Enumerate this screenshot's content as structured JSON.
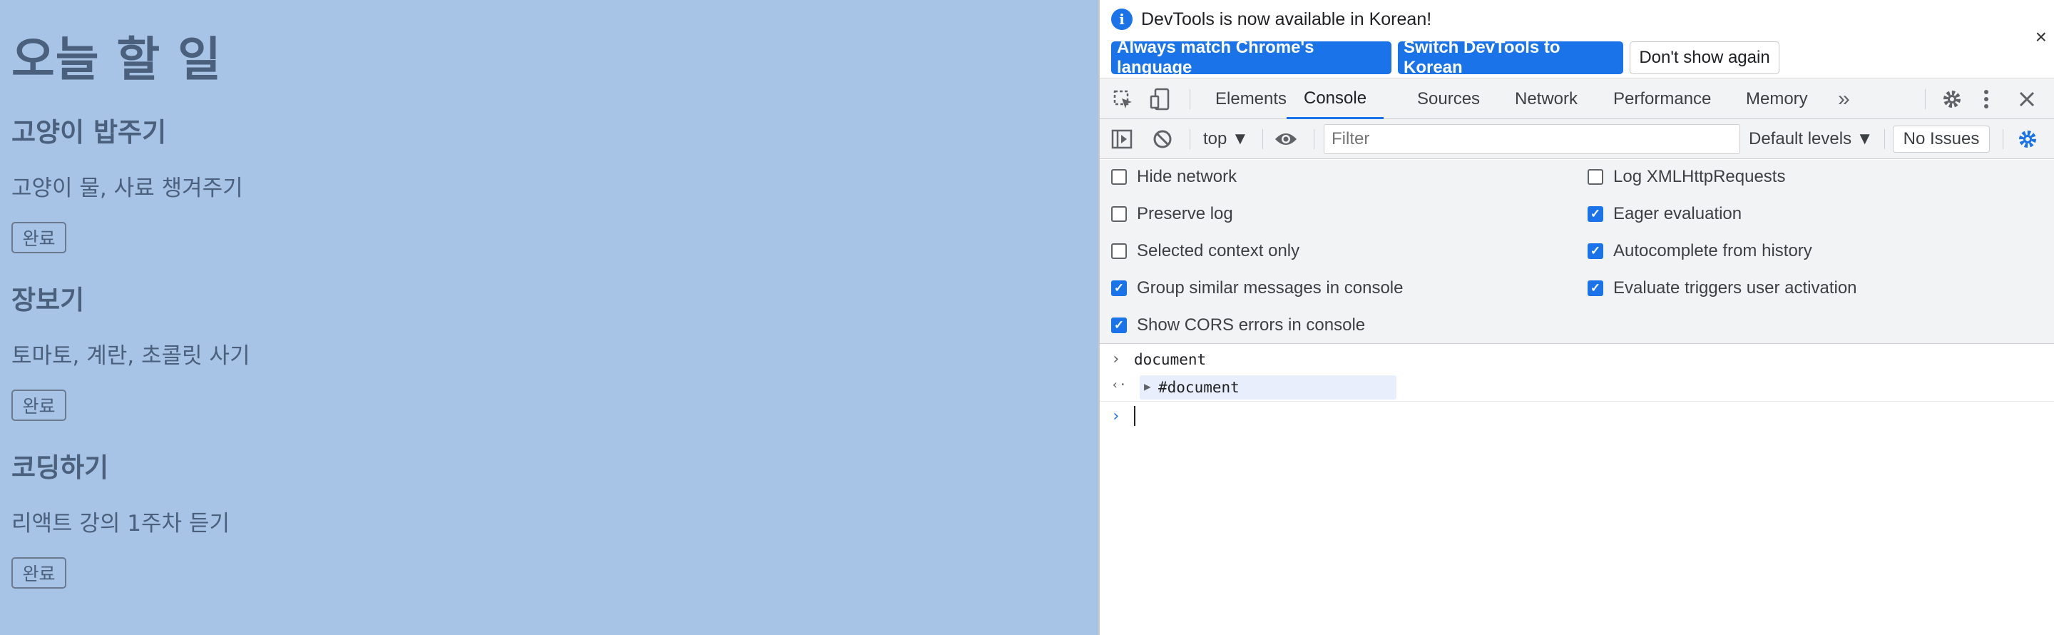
{
  "page": {
    "title": "오늘 할 일",
    "todos": [
      {
        "title": "고양이 밥주기",
        "desc": "고양이 물, 사료 챙겨주기",
        "button": "완료"
      },
      {
        "title": "장보기",
        "desc": "토마토, 계란, 초콜릿 사기",
        "button": "완료"
      },
      {
        "title": "코딩하기",
        "desc": "리액트 강의 1주차 듣기",
        "button": "완료"
      }
    ]
  },
  "devtools": {
    "infobar": {
      "message": "DevTools is now available in Korean!",
      "btn_match": "Always match Chrome's language",
      "btn_switch": "Switch DevTools to Korean",
      "btn_dont_show": "Don't show again",
      "close": "×"
    },
    "tabs": [
      "Elements",
      "Console",
      "Sources",
      "Network",
      "Performance",
      "Memory"
    ],
    "active_tab": "Console",
    "more_tabs": "»",
    "toolbar": {
      "context": "top ▼",
      "filter_placeholder": "Filter",
      "levels": "Default levels ▼",
      "issues": "No Issues"
    },
    "settings": {
      "left": [
        {
          "label": "Hide network",
          "checked": false
        },
        {
          "label": "Preserve log",
          "checked": false
        },
        {
          "label": "Selected context only",
          "checked": false
        },
        {
          "label": "Group similar messages in console",
          "checked": true
        },
        {
          "label": "Show CORS errors in console",
          "checked": true
        }
      ],
      "right": [
        {
          "label": "Log XMLHttpRequests",
          "checked": false
        },
        {
          "label": "Eager evaluation",
          "checked": true
        },
        {
          "label": "Autocomplete from history",
          "checked": true
        },
        {
          "label": "Evaluate triggers user activation",
          "checked": true
        }
      ]
    },
    "console": {
      "input": "document",
      "result": "#document"
    },
    "colors": {
      "accent": "#1a73e8",
      "page_bg": "#a7c3e5",
      "page_text": "#4b607d"
    }
  }
}
